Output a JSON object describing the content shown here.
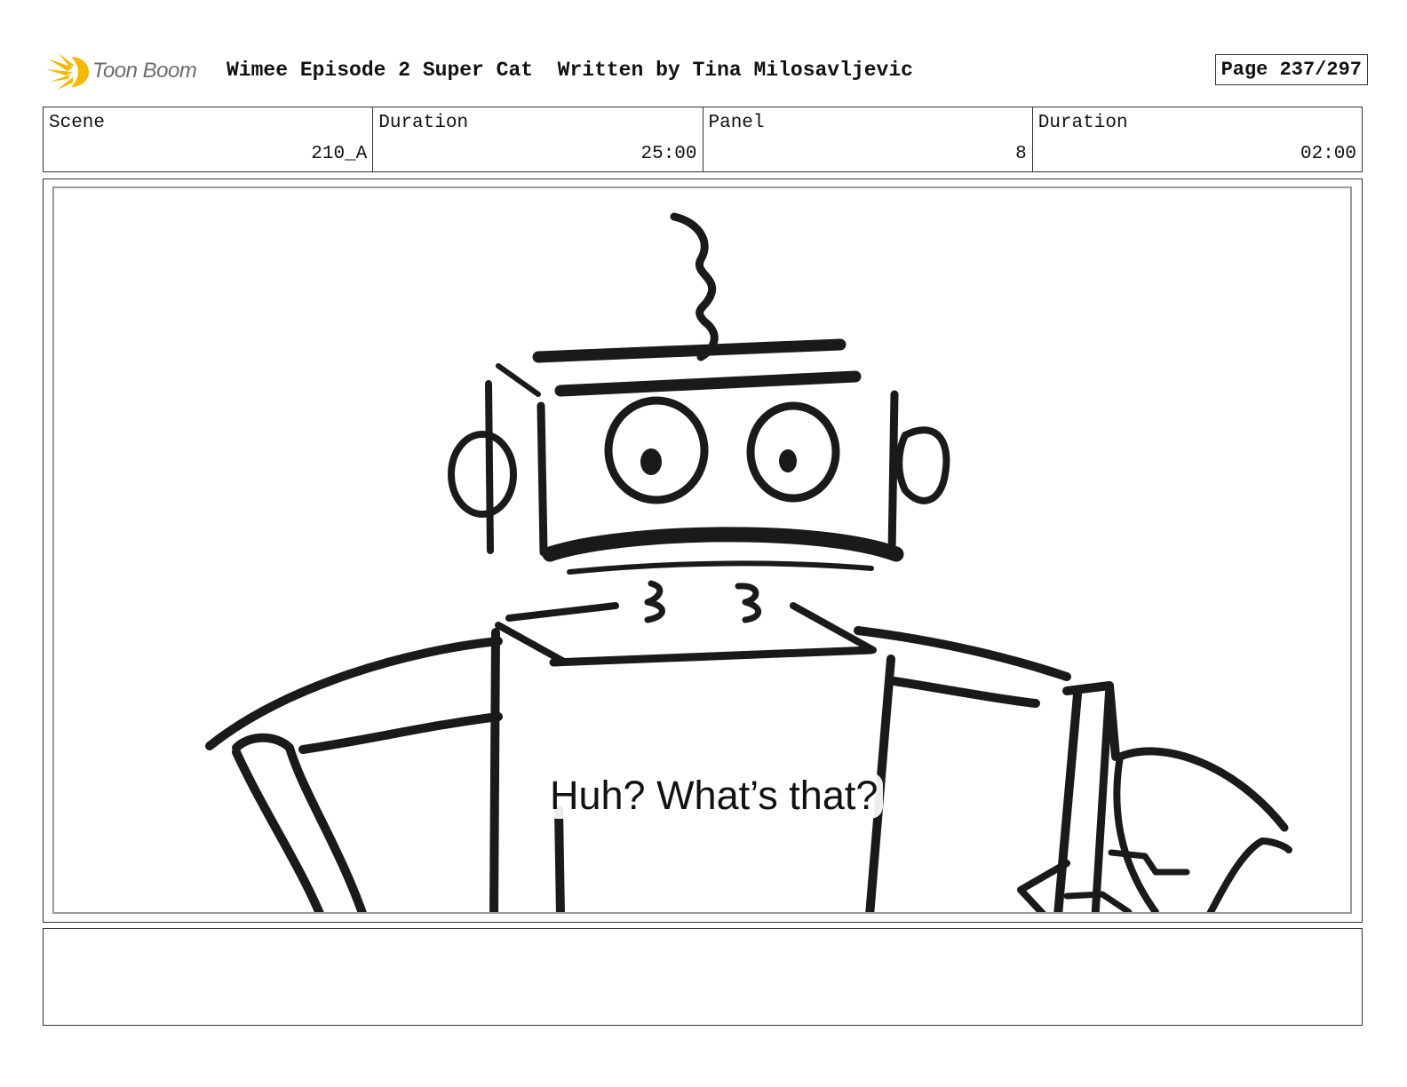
{
  "header": {
    "logo_text": "Toon Boom",
    "title": "Wimee Episode 2 Super Cat  Written by Tina Milosavljevic",
    "page_label": "Page 237/297"
  },
  "info": {
    "scene_label": "Scene",
    "scene_value": "210_A",
    "scene_duration_label": "Duration",
    "scene_duration_value": "25:00",
    "panel_label": "Panel",
    "panel_value": "8",
    "panel_duration_label": "Duration",
    "panel_duration_value": "02:00"
  },
  "panel": {
    "dialogue": "Huh? What’s that?"
  },
  "colors": {
    "logo_accent": "#f5b800",
    "sketch_ink": "#1a1a1a"
  },
  "icons": [
    "toon-boom-logo-icon"
  ]
}
